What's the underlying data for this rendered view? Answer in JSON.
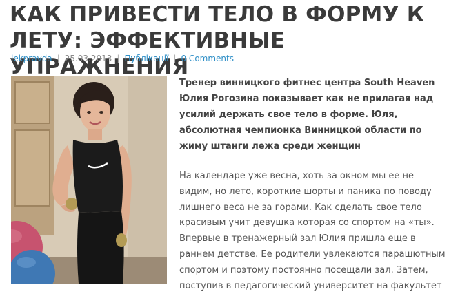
{
  "article": {
    "title": "КАК ПРИВЕСТИ ТЕЛО В ФОРМУ К ЛЕТУ: ЭФФЕКТИВНЫЕ УПРАЖНЕНИЯ",
    "meta": {
      "author": "lekpravda",
      "date": "25.03.2013",
      "category": "Публікації",
      "comments": "0 Comments",
      "separator": "|"
    },
    "lead": "Тренер винницкого фитнес центра South Heaven Юлия Рогозина показывает как не прилагая над усилий держать свое тело в форме. Юля, абсолютная чемпионка Винницкой области по жиму штанги лежа среди женщин",
    "paragraphs": [
      "На календаре уже весна, хоть за окном мы ее не видим, но лето, короткие шорты и паника по поводу лишнего веса не за горами. Как сделать свое тело красивым учит девушка которая со спортом на «ты».",
      "Впервые в тренажерный зал Юлия пришла еще в раннем детстве. Ее родители увлекаются парашютным спортом и поэтому постоянно посещали зал. Затем, поступив в педагогический университет на факультет"
    ]
  },
  "colors": {
    "title": "#3a3a3a",
    "link": "#2f8fc7",
    "meta_text": "#8a8a8a",
    "body_text": "#555555"
  }
}
